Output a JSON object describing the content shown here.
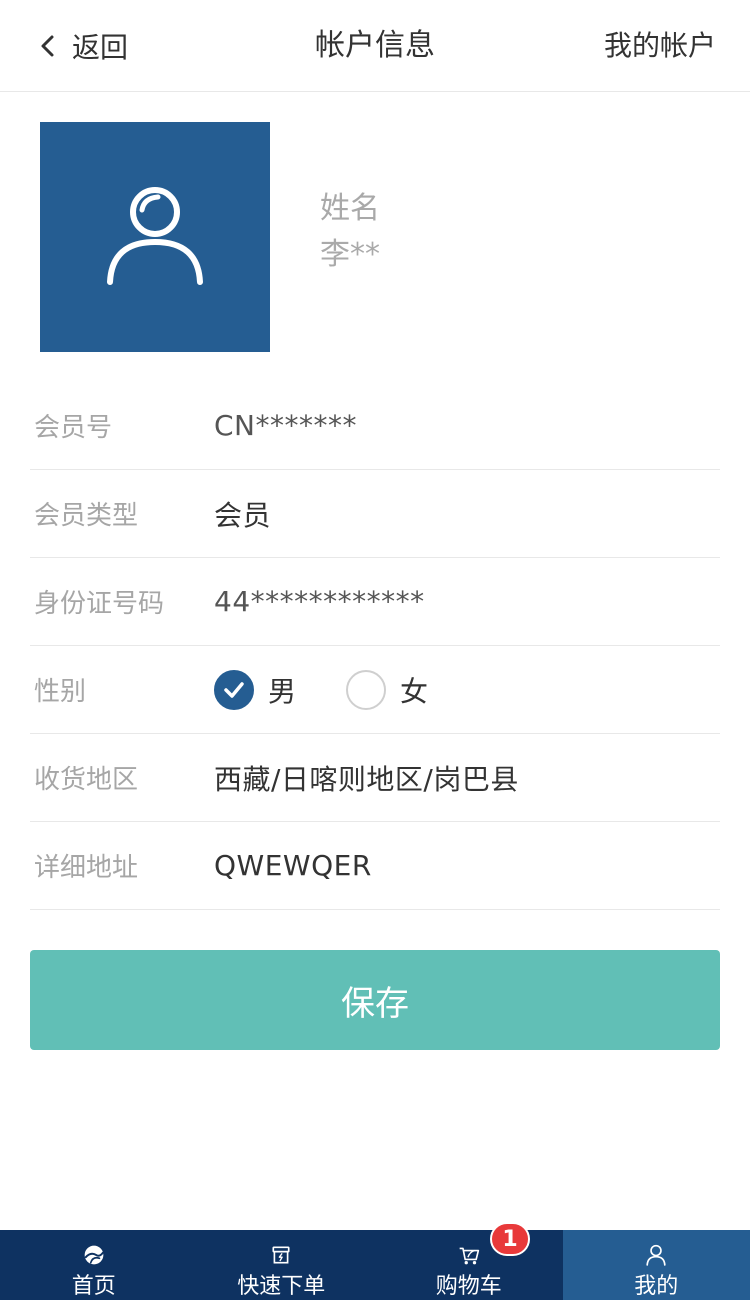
{
  "header": {
    "back_label": "返回",
    "title": "帐户信息",
    "right_label": "我的帐户"
  },
  "profile": {
    "name_label": "姓名",
    "name_value": "李**"
  },
  "form": {
    "member_no": {
      "label": "会员号",
      "value": "CN*******"
    },
    "member_type": {
      "label": "会员类型",
      "value": "会员"
    },
    "id_number": {
      "label": "身份证号码",
      "value": "44************"
    },
    "gender": {
      "label": "性别",
      "options": [
        {
          "label": "男",
          "checked": true
        },
        {
          "label": "女",
          "checked": false
        }
      ]
    },
    "region": {
      "label": "收货地区",
      "value": "西藏/日喀则地区/岗巴县"
    },
    "address": {
      "label": "详细地址",
      "value": "QWEWQER"
    }
  },
  "save_button": {
    "label": "保存"
  },
  "tabbar": {
    "items": [
      {
        "label": "首页",
        "icon": "home-logo-icon",
        "active": false
      },
      {
        "label": "快速下单",
        "icon": "store-icon",
        "active": false
      },
      {
        "label": "购物车",
        "icon": "cart-icon",
        "active": false,
        "badge": "1"
      },
      {
        "label": "我的",
        "icon": "user-icon",
        "active": true
      }
    ]
  },
  "colors": {
    "primary": "#255d92",
    "tabbar_bg": "#0e3261",
    "save_button": "#61bfb6",
    "badge": "#e8393a"
  }
}
